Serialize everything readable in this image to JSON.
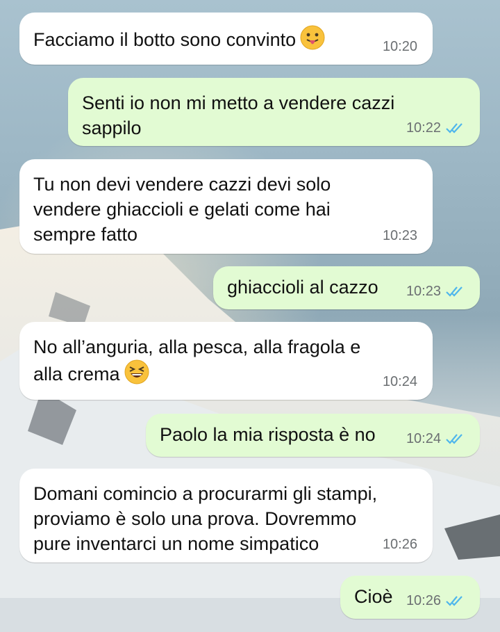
{
  "colors": {
    "incoming_bubble": "#ffffff",
    "outgoing_bubble": "#e2fbd3",
    "time_text": "#6b6f72",
    "read_ticks": "#4fb6ec"
  },
  "messages": [
    {
      "direction": "in",
      "text": "Facciamo il botto sono convinto",
      "emoji": "tongue-out-emoji",
      "time": "10:20"
    },
    {
      "direction": "out",
      "text": "Senti io non mi metto a vendere cazzi\nsappilo",
      "time": "10:22",
      "status": "read"
    },
    {
      "direction": "in",
      "text": "Tu non devi vendere cazzi devi solo\nvendere ghiaccioli e gelati come hai\nsempre fatto",
      "time": "10:23"
    },
    {
      "direction": "out",
      "text": "ghiaccioli al cazzo",
      "time": "10:23",
      "status": "read"
    },
    {
      "direction": "in",
      "text": "No all’anguria, alla pesca, alla fragola e\nalla crema",
      "emoji": "laughing-emoji",
      "time": "10:24"
    },
    {
      "direction": "out",
      "text": "Paolo la mia risposta è no",
      "time": "10:24",
      "status": "read"
    },
    {
      "direction": "in",
      "text": "Domani comincio a procurarmi gli stampi,\nproviamo è solo una prova. Dovremmo\npure inventarci un nome simpatico",
      "time": "10:26"
    },
    {
      "direction": "out",
      "text": "Cioè",
      "time": "10:26",
      "status": "read"
    }
  ]
}
